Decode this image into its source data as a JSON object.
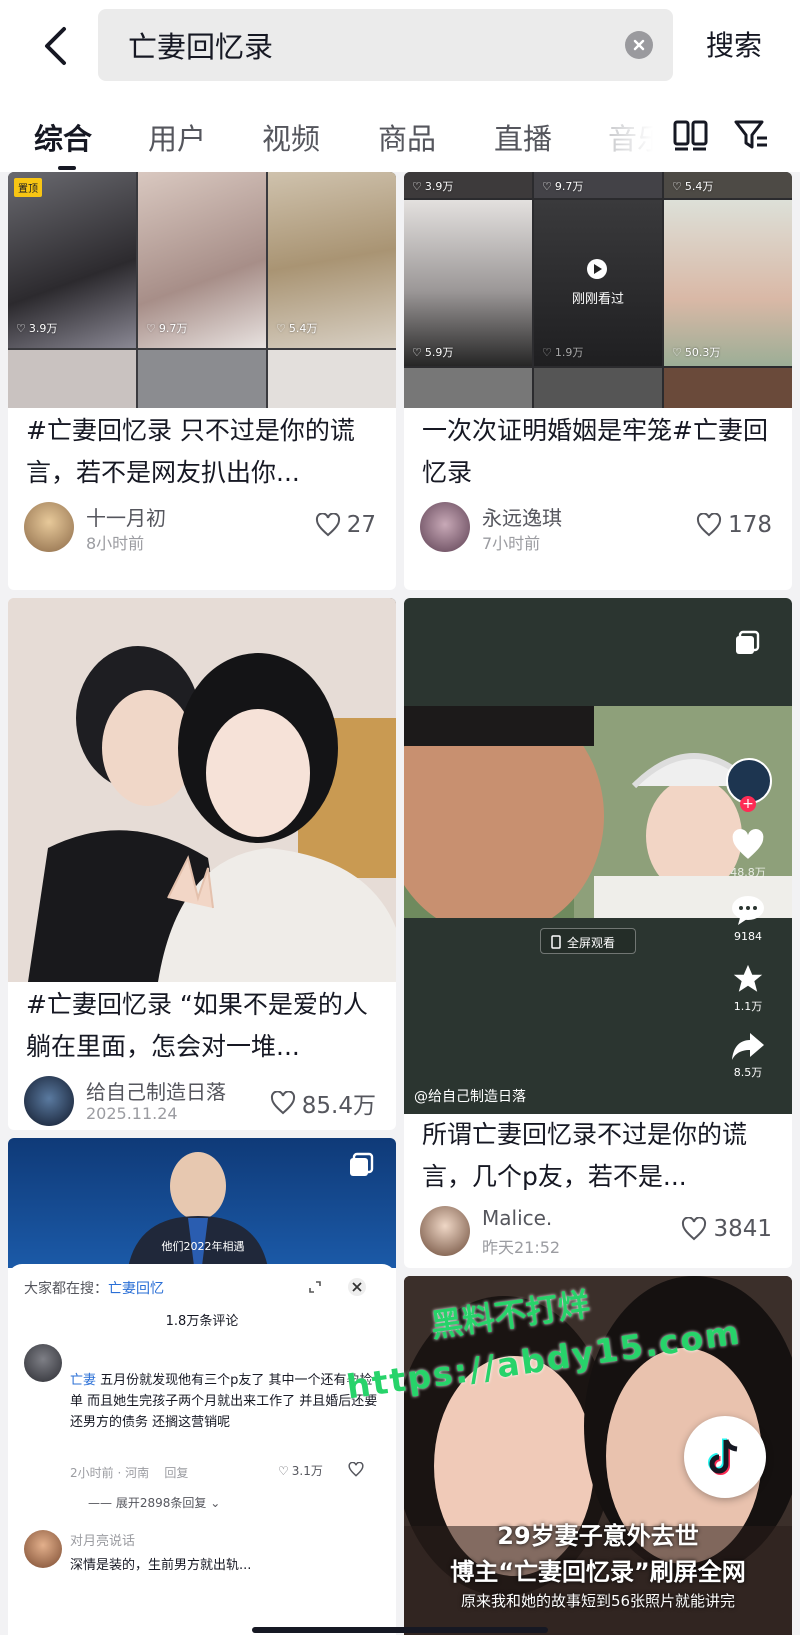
{
  "header": {
    "query": "亡妻回忆录",
    "search_label": "搜索"
  },
  "tabs": [
    {
      "label": "综合"
    },
    {
      "label": "用户"
    },
    {
      "label": "视频"
    },
    {
      "label": "商品"
    },
    {
      "label": "直播"
    },
    {
      "label": "音乐"
    }
  ],
  "cards": {
    "c1": {
      "pin_label": "置顶",
      "tiles_likes": [
        "3.9万",
        "9.7万",
        "5.4万"
      ],
      "title": "#亡妻回忆录 只不过是你的谎言，若不是网友扒出你...",
      "author": "十一月初",
      "time": "8小时前",
      "likes": "27"
    },
    "c2": {
      "tiles_top_likes": [
        "3.9万",
        "9.7万",
        "5.4万"
      ],
      "tiles_bottom_likes": [
        "5.9万",
        "1.9万",
        "50.3万"
      ],
      "watched_label": "刚刚看过",
      "title": "一次次证明婚姻是牢笼#亡妻回忆录",
      "author": "永远逸琪",
      "time": "7小时前",
      "likes": "178"
    },
    "c3": {
      "title": "#亡妻回忆录 “如果不是爱的人躺在里面，怎会对一堆...",
      "author": "给自己制造日落",
      "time": "2025.11.24",
      "likes": "85.4万"
    },
    "c4": {
      "fullscreen_label": "全屏观看",
      "side_likes": "48.8万",
      "side_comments": "9184",
      "side_favs": "1.1万",
      "side_shares": "8.5万",
      "handle": "@给自己制造日落",
      "title": "所谓亡妻回忆录不过是你的谎言，几个p友，若不是...",
      "author": "Malice.",
      "time": "昨天21:52",
      "likes": "3841"
    },
    "c5": {
      "subtitle": "他们2022年相遇",
      "searching_prefix": "大家都在搜：",
      "searching_term": "亡妻回忆",
      "comment_count": "1.8万条评论",
      "comment1_author_tag": "亡妻",
      "comment1_text": "五月份就发现他有三个p友了 其中一个还有孕检单 而且她生完孩子两个月就出来工作了 并且婚后还要还男方的债务 还搁这营销呢",
      "comment1_time": "2小时前 · 河南",
      "reply_label": "回复",
      "comment1_likes": "3.1万",
      "expand_label": "展开2898条回复",
      "comment2_author": "对月亮说话",
      "comment2_text": "深情是装的，生前男方就出轨..."
    },
    "c6": {
      "headline1": "29岁妻子意外去世",
      "headline2": "博主“亡妻回忆录”刷屏全网",
      "headline3": "原来我和她的故事短到56张照片就能讲完"
    }
  },
  "watermark": {
    "line1": "黑料不打烊",
    "line2": "https://abdy15.com"
  },
  "colors": {
    "text_primary": "#161823",
    "text_secondary": "#55565d",
    "feed_bg": "#f2f2f4",
    "watermark": "#27d36a",
    "like_red": "#fe2c55"
  }
}
